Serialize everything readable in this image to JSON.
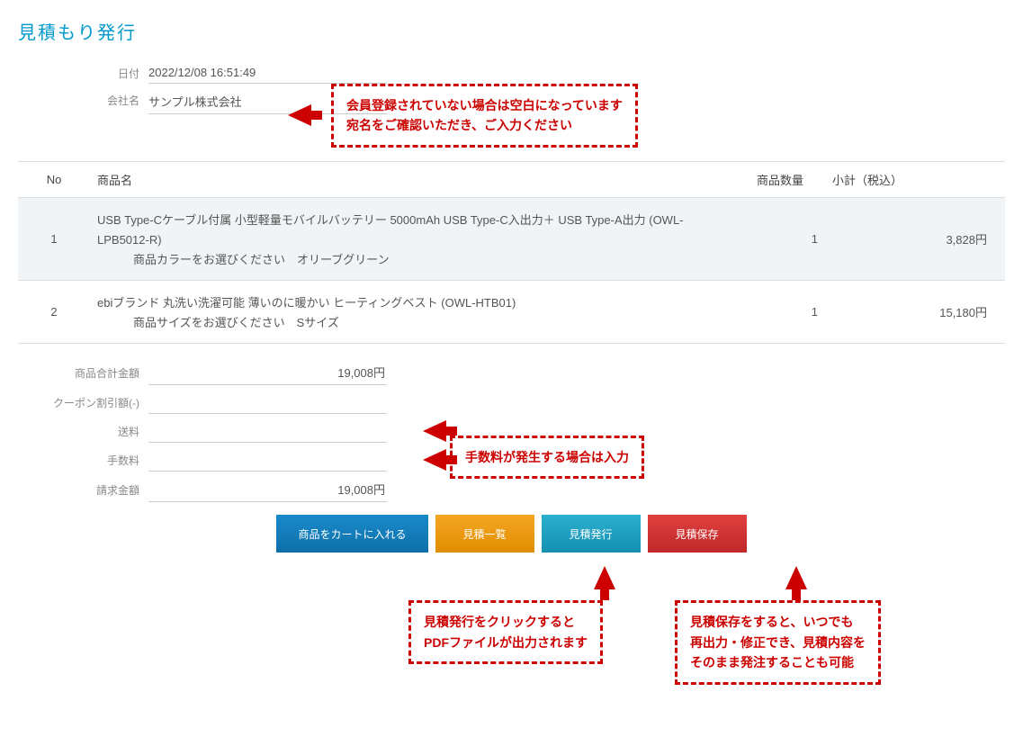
{
  "pageTitle": "見積もり発行",
  "header": {
    "dateLabel": "日付",
    "dateValue": "2022/12/08 16:51:49",
    "companyLabel": "会社名",
    "companyValue": "サンプル株式会社"
  },
  "calloutTop": "会員登録されていない場合は空白になっています\n宛名をご確認いただき、ご入力ください",
  "table": {
    "headers": {
      "no": "No",
      "name": "商品名",
      "qty": "商品数量",
      "subtotal": "小計（税込）"
    },
    "rows": [
      {
        "no": "1",
        "name": "USB Type-Cケーブル付属 小型軽量モバイルバッテリー 5000mAh USB Type-C入出力＋ USB Type-A出力 (OWL-LPB5012-R)",
        "option": "商品カラーをお選びください　オリーブグリーン",
        "qty": "1",
        "subtotal": "3,828円"
      },
      {
        "no": "2",
        "name": "ebiブランド 丸洗い洗濯可能 薄いのに暖かい ヒーティングベスト (OWL-HTB01)",
        "option": "商品サイズをお選びください　Sサイズ",
        "qty": "1",
        "subtotal": "15,180円"
      }
    ]
  },
  "totals": {
    "productTotalLabel": "商品合計金額",
    "productTotalValue": "19,008円",
    "couponLabel": "クーポン割引額(-)",
    "couponValue": "",
    "shippingLabel": "送料",
    "shippingValue": "",
    "feeLabel": "手数料",
    "feeValue": "",
    "billingLabel": "請求金額",
    "billingValue": "19,008円"
  },
  "calloutMid": "手数料が発生する場合は入力",
  "buttons": {
    "cart": "商品をカートに入れる",
    "list": "見積一覧",
    "issue": "見積発行",
    "save": "見積保存"
  },
  "calloutIssue": "見積発行をクリックすると\nPDFファイルが出力されます",
  "calloutSave": "見積保存をすると、いつでも\n再出力・修正でき、見積内容を\nそのまま発注することも可能"
}
